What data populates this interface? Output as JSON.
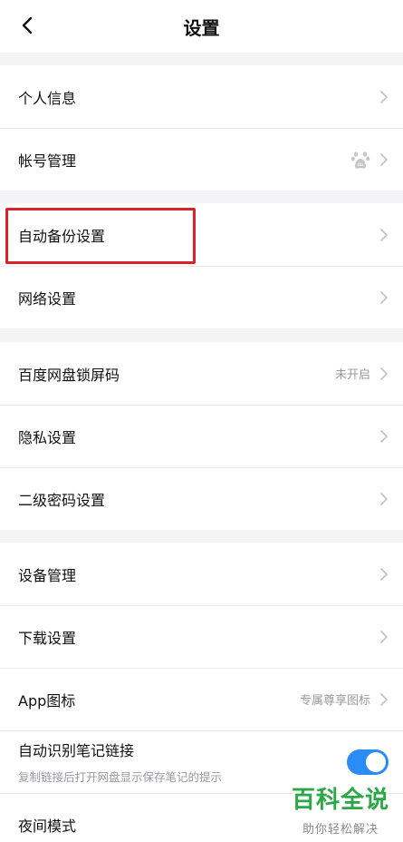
{
  "header": {
    "title": "设置"
  },
  "groups": [
    {
      "items": [
        {
          "label": "个人信息"
        },
        {
          "label": "帐号管理"
        }
      ]
    },
    {
      "items": [
        {
          "label": "自动备份设置"
        },
        {
          "label": "网络设置"
        }
      ]
    },
    {
      "items": [
        {
          "label": "百度网盘锁屏码",
          "value": "未开启"
        },
        {
          "label": "隐私设置"
        },
        {
          "label": "二级密码设置"
        }
      ]
    },
    {
      "items": [
        {
          "label": "设备管理"
        },
        {
          "label": "下载设置"
        },
        {
          "label": "App图标",
          "value": "专属尊享图标"
        },
        {
          "label": "自动识别笔记链接",
          "subtitle": "复制链接后打开网盘显示保存笔记的提示",
          "toggle_on": true
        },
        {
          "label": "夜间模式"
        }
      ]
    }
  ],
  "icons": {
    "back": "chevron-left-icon",
    "row_arrow": "chevron-right-icon",
    "account_badge": "baidu-paw-icon"
  },
  "colors": {
    "accent": "#2b8cf5",
    "highlight": "#d8232a",
    "watermark": "#2aa845"
  },
  "watermark": {
    "main": "百科全说",
    "sub": "助你轻松解决"
  }
}
